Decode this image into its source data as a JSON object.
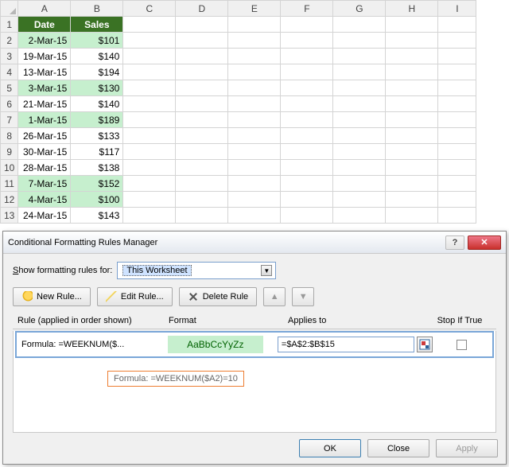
{
  "sheet": {
    "columns": [
      "A",
      "B",
      "C",
      "D",
      "E",
      "F",
      "G",
      "H",
      "I"
    ],
    "headers": {
      "date": "Date",
      "sales": "Sales"
    },
    "rows": [
      {
        "n": 1,
        "date": "Date",
        "sales": "Sales",
        "header": true
      },
      {
        "n": 2,
        "date": "2-Mar-15",
        "sales": "$101",
        "hl": true
      },
      {
        "n": 3,
        "date": "19-Mar-15",
        "sales": "$140"
      },
      {
        "n": 4,
        "date": "13-Mar-15",
        "sales": "$194"
      },
      {
        "n": 5,
        "date": "3-Mar-15",
        "sales": "$130",
        "hl": true
      },
      {
        "n": 6,
        "date": "21-Mar-15",
        "sales": "$140"
      },
      {
        "n": 7,
        "date": "1-Mar-15",
        "sales": "$189",
        "hl": true
      },
      {
        "n": 8,
        "date": "26-Mar-15",
        "sales": "$133"
      },
      {
        "n": 9,
        "date": "30-Mar-15",
        "sales": "$117"
      },
      {
        "n": 10,
        "date": "28-Mar-15",
        "sales": "$138"
      },
      {
        "n": 11,
        "date": "7-Mar-15",
        "sales": "$152",
        "hl": true
      },
      {
        "n": 12,
        "date": "4-Mar-15",
        "sales": "$100",
        "hl": true
      },
      {
        "n": 13,
        "date": "24-Mar-15",
        "sales": "$143"
      }
    ]
  },
  "dialog": {
    "title": "Conditional Formatting Rules Manager",
    "help": "?",
    "close": "✕",
    "show_label_pre": "S",
    "show_label_post": "how formatting rules for:",
    "scope_selected": "This Worksheet",
    "buttons": {
      "new": "New Rule...",
      "edit": "Edit Rule...",
      "delete": "Delete Rule",
      "up": "▲",
      "down": "▼"
    },
    "headers": {
      "rule": "Rule (applied in order shown)",
      "format": "Format",
      "applies": "Applies to",
      "stop": "Stop If True"
    },
    "rule": {
      "short": "Formula: =WEEKNUM($...",
      "preview": "AaBbCcYyZz",
      "applies_to": "=$A$2:$B$15"
    },
    "tooltip": "Formula: =WEEKNUM($A2)=10",
    "footer": {
      "ok": "OK",
      "close": "Close",
      "apply": "Apply"
    }
  }
}
